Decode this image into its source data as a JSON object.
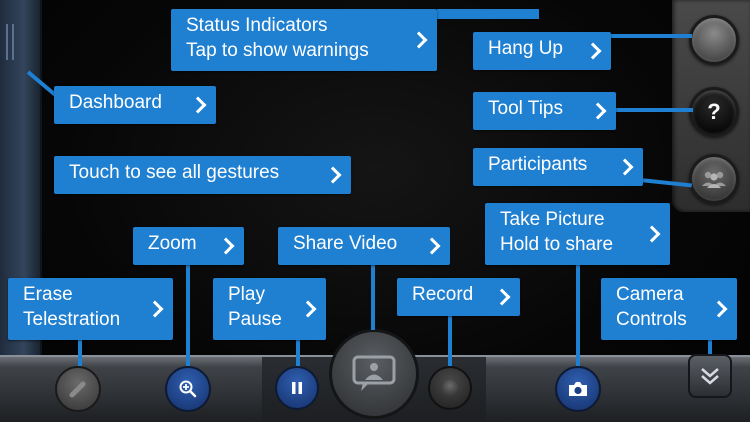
{
  "callouts": {
    "status": {
      "line1": "Status Indicators",
      "line2": "Tap to show warnings"
    },
    "hang_up": {
      "label": "Hang Up"
    },
    "dashboard": {
      "label": "Dashboard"
    },
    "tool_tips": {
      "label": "Tool Tips"
    },
    "gestures": {
      "label": "Touch to see all gestures"
    },
    "participants": {
      "label": "Participants"
    },
    "zoom": {
      "label": "Zoom"
    },
    "share_video": {
      "label": "Share Video"
    },
    "take_picture": {
      "line1": "Take Picture",
      "line2": "Hold to share"
    },
    "erase": {
      "line1": "Erase",
      "line2": "Telestration"
    },
    "play": {
      "line1": "Play",
      "line2": "Pause"
    },
    "record": {
      "label": "Record"
    },
    "camera_controls": {
      "line1": "Camera",
      "line2": "Controls"
    }
  },
  "right_buttons": {
    "tool_tips_glyph": "?"
  },
  "icons": {
    "pause": "pause-icon",
    "zoom": "zoom-in-icon",
    "camera": "camera-icon",
    "share": "share-video-icon",
    "more": "chevron-double-down-icon",
    "participants": "participants-icon",
    "eraser": "eraser-icon"
  },
  "colors": {
    "callout": "#1f7fd0",
    "accent_button": "#2f5fb0",
    "background": "#050505"
  }
}
